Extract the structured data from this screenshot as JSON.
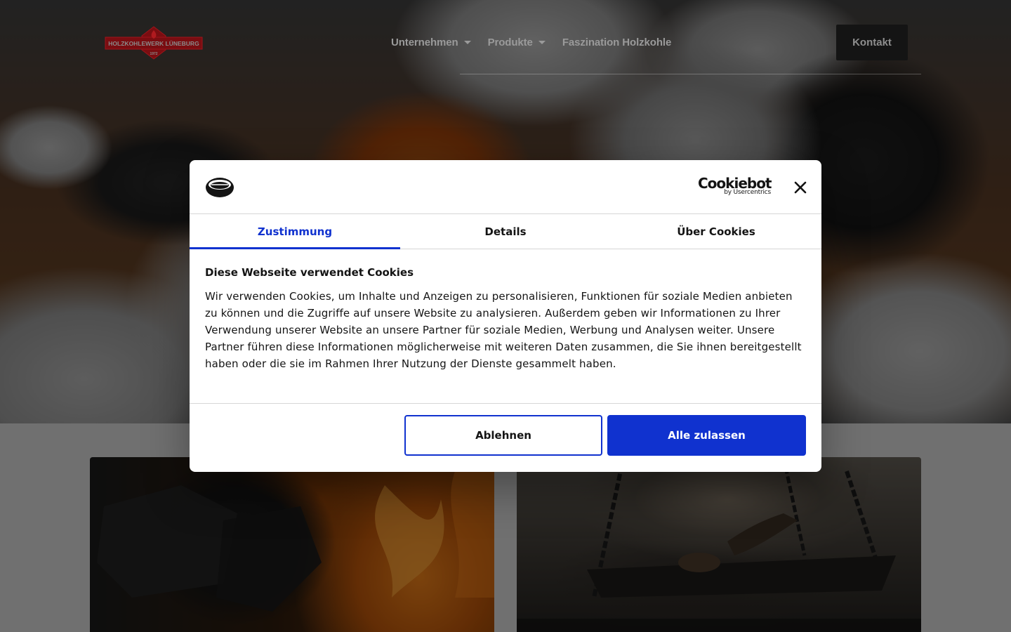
{
  "header": {
    "logo": {
      "text": "HOLZKOHLEWERK LÜNEBURG",
      "year": "1972",
      "color": "#c8141c"
    },
    "nav": [
      {
        "label": "Unternehmen",
        "has_dropdown": true,
        "icon": "caret-down-icon"
      },
      {
        "label": "Produkte",
        "has_dropdown": true,
        "icon": "caret-down-icon"
      },
      {
        "label": "Faszination Holzkohle",
        "has_dropdown": false
      }
    ],
    "cta_label": "Kontakt"
  },
  "cookie_dialog": {
    "brand": "Cookiebot",
    "brand_sub": "by Usercentrics",
    "close_icon": "close-icon",
    "tabs": [
      {
        "label": "Zustimmung",
        "active": true
      },
      {
        "label": "Details",
        "active": false
      },
      {
        "label": "Über Cookies",
        "active": false
      }
    ],
    "title": "Diese Webseite verwendet Cookies",
    "text": "Wir verwenden Cookies, um Inhalte und Anzeigen zu personalisieren, Funktionen für soziale Medien anbieten zu können und die Zugriffe auf unsere Website zu analysieren. Außerdem geben wir Informationen zu Ihrer Verwendung unserer Website an unsere Partner für soziale Medien, Werbung und Analysen weiter. Unsere Partner führen diese Informationen möglicherweise mit weiteren Daten zusammen, die Sie ihnen bereitgestellt haben oder die sie im Rahmen Ihrer Nutzung der Dienste gesammelt haben.",
    "reject_label": "Ablehnen",
    "accept_label": "Alle zulassen",
    "accent_color": "#1032cf"
  }
}
